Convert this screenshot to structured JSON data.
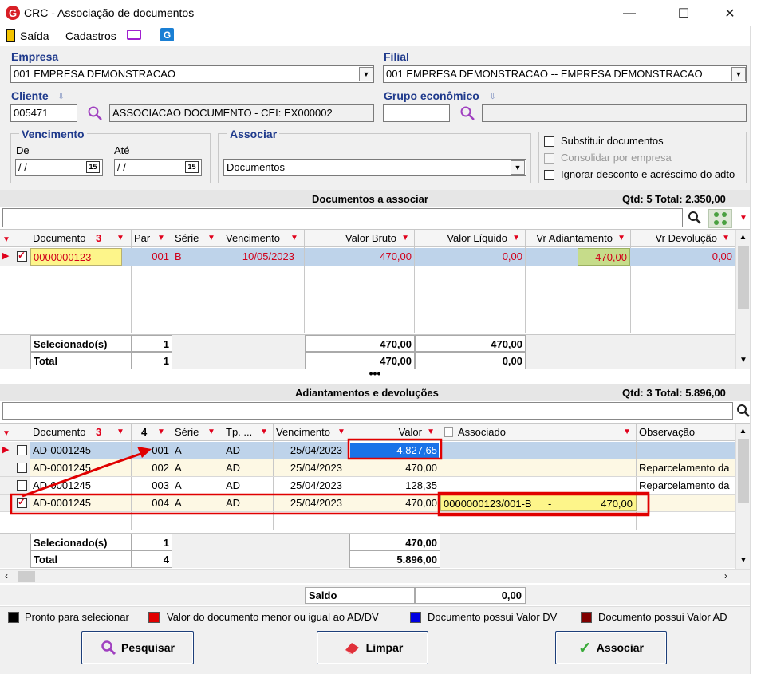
{
  "window": {
    "title": "CRC - Associação de documentos",
    "minimize": "—",
    "maximize": "☐",
    "close": "✕"
  },
  "menu": {
    "exit": "Saída",
    "register": "Cadastros"
  },
  "form": {
    "company_label": "Empresa",
    "company_value": "001 EMPRESA DEMONSTRACAO",
    "branch_label": "Filial",
    "branch_value": "001 EMPRESA DEMONSTRACAO -- EMPRESA DEMONSTRACAO",
    "client_label": "Cliente",
    "client_code": "005471",
    "client_name": "ASSOCIACAO DOCUMENTO - CEI: EX000002",
    "group_label": "Grupo econômico",
    "group_code": "",
    "group_name": "",
    "due_label": "Vencimento",
    "from_label": "De",
    "to_label": "Até",
    "from_value": " / /",
    "to_value": " / /",
    "cal": "15",
    "associate_label": "Associar",
    "associate_value": "Documentos",
    "opt_replace": "Substituir documentos",
    "opt_consolidate": "Consolidar por empresa",
    "opt_ignore": "Ignorar desconto e acréscimo do adto"
  },
  "docs": {
    "title": "Documentos a associar",
    "summary": "Qtd: 5 Total: 2.350,00",
    "columns": {
      "doc": "Documento",
      "par": "Par",
      "serie": "Série",
      "venc": "Vencimento",
      "bruto": "Valor Bruto",
      "liquido": "Valor Líquido",
      "adiant": "Vr Adiantamento",
      "devol": "Vr Devolução"
    },
    "sort_doc": "3",
    "row": {
      "doc": "0000000123",
      "par": "001",
      "serie": "B",
      "venc": "10/05/2023",
      "bruto": "470,00",
      "liquido": "0,00",
      "adiant": "470,00",
      "devol": "0,00"
    },
    "selected_label": "Selecionado(s)",
    "selected_count": "1",
    "selected_bruto": "470,00",
    "selected_liquido": "470,00",
    "total_label": "Total",
    "total_count": "1",
    "total_bruto": "470,00",
    "total_liquido": "0,00"
  },
  "adv": {
    "title": "Adiantamentos e devoluções",
    "summary": "Qtd: 3 Total: 5.896,00",
    "columns": {
      "doc": "Documento",
      "num": "4",
      "serie": "Série",
      "tp": "Tp. ...",
      "venc": "Vencimento",
      "valor": "Valor",
      "assoc": "Associado",
      "obs": "Observação"
    },
    "sort_doc": "3",
    "rows": [
      {
        "doc": "AD-0001245",
        "par": "001",
        "serie": "A",
        "tp": "AD",
        "venc": "25/04/2023",
        "valor": "4.827,65",
        "assoc": "",
        "obs": ""
      },
      {
        "doc": "AD-0001245",
        "par": "002",
        "serie": "A",
        "tp": "AD",
        "venc": "25/04/2023",
        "valor": "470,00",
        "assoc": "",
        "obs": "Reparcelamento da"
      },
      {
        "doc": "AD-0001245",
        "par": "003",
        "serie": "A",
        "tp": "AD",
        "venc": "25/04/2023",
        "valor": "128,35",
        "assoc": "",
        "obs": "Reparcelamento da"
      },
      {
        "doc": "AD-0001245",
        "par": "004",
        "serie": "A",
        "tp": "AD",
        "venc": "25/04/2023",
        "valor": "470,00",
        "assoc": "0000000123/001-B",
        "assoc_dash": "-",
        "assoc_val": "470,00",
        "obs": ""
      }
    ],
    "selected_label": "Selecionado(s)",
    "selected_count": "1",
    "selected_valor": "470,00",
    "total_label": "Total",
    "total_count": "4",
    "total_valor": "5.896,00"
  },
  "saldo": {
    "label": "Saldo",
    "value": "0,00"
  },
  "legend": [
    {
      "color": "#000000",
      "text": "Pronto para selecionar"
    },
    {
      "color": "#e00000",
      "text": "Valor do documento menor ou igual ao AD/DV"
    },
    {
      "color": "#0000e0",
      "text": "Documento possui Valor DV"
    },
    {
      "color": "#800000",
      "text": "Documento possui Valor AD"
    }
  ],
  "buttons": {
    "search": "Pesquisar",
    "clear": "Limpar",
    "associate": "Associar"
  }
}
